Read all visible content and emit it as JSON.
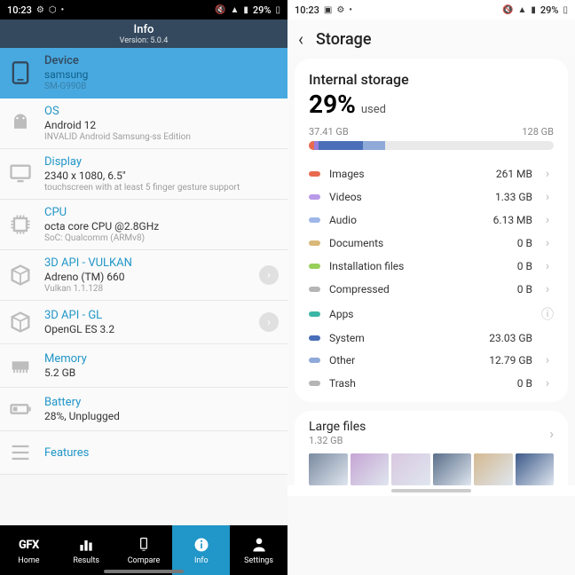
{
  "status": {
    "time": "10:23",
    "left_icons": [
      "gear-icon",
      "shield-icon",
      "dot-icon"
    ],
    "right_icons": [
      "mute-icon",
      "wifi-icon",
      "signal-icon"
    ],
    "battery": "29%"
  },
  "left": {
    "header": {
      "title": "Info",
      "version": "Version: 5.0.4"
    },
    "rows": [
      {
        "icon": "tablet-icon",
        "title": "Device",
        "line1": "samsung",
        "line2": "SM-G990B",
        "selected": true
      },
      {
        "icon": "android-icon",
        "title": "OS",
        "line1": "Android 12",
        "line2": "INVALID Android Samsung-ss Edition"
      },
      {
        "icon": "monitor-icon",
        "title": "Display",
        "line1": "2340 x 1080, 6.5\"",
        "line2": "touchscreen with at least 5 finger gesture support"
      },
      {
        "icon": "cpu-icon",
        "title": "CPU",
        "line1": "octa core CPU @2.8GHz",
        "line2": "SoC: Qualcomm (ARMv8)"
      },
      {
        "icon": "cube-icon",
        "title": "3D API - VULKAN",
        "line1": "Adreno (TM) 660",
        "line2": "Vulkan 1.1.128",
        "chevron": true
      },
      {
        "icon": "cube-icon",
        "title": "3D API - GL",
        "line1": "OpenGL ES 3.2",
        "chevron": true
      },
      {
        "icon": "memory-icon",
        "title": "Memory",
        "line1": "5.2 GB"
      },
      {
        "icon": "battery-icon",
        "title": "Battery",
        "line1": "28%, Unplugged"
      },
      {
        "icon": "list-icon",
        "title": "Features"
      }
    ],
    "nav": [
      {
        "icon": "gfx",
        "label": "Home"
      },
      {
        "icon": "results-icon",
        "label": "Results"
      },
      {
        "icon": "compare-icon",
        "label": "Compare"
      },
      {
        "icon": "info-icon",
        "label": "Info",
        "active": true
      },
      {
        "icon": "settings-icon",
        "label": "Settings"
      }
    ]
  },
  "right": {
    "title": "Storage",
    "card": {
      "heading": "Internal storage",
      "percent": "29%",
      "percent_label": "used",
      "used": "37.41 GB",
      "total": "128 GB"
    },
    "bar_segments": [
      {
        "color": "#e86a4e",
        "w": 2
      },
      {
        "color": "#9a7edc",
        "w": 2
      },
      {
        "color": "#4a6fb8",
        "w": 18
      },
      {
        "color": "#8fa9d8",
        "w": 9
      }
    ],
    "categories": [
      {
        "color": "#e86a4e",
        "name": "Images",
        "value": "261 MB",
        "arrow": true
      },
      {
        "color": "#b89ae8",
        "name": "Videos",
        "value": "1.33 GB",
        "arrow": true
      },
      {
        "color": "#9fb7e8",
        "name": "Audio",
        "value": "6.13 MB",
        "arrow": true
      },
      {
        "color": "#d9b87a",
        "name": "Documents",
        "value": "0 B",
        "arrow": true
      },
      {
        "color": "#97cf5a",
        "name": "Installation files",
        "value": "0 B",
        "arrow": true
      },
      {
        "color": "#b5b5b5",
        "name": "Compressed",
        "value": "0 B",
        "arrow": true
      },
      {
        "color": "#3bb6a6",
        "name": "Apps",
        "value": "",
        "info": true
      },
      {
        "color": "#4a6fb8",
        "name": "System",
        "value": "23.03 GB"
      },
      {
        "color": "#8fa9d8",
        "name": "Other",
        "value": "12.79 GB",
        "arrow": true
      },
      {
        "color": "#b5b5b5",
        "name": "Trash",
        "value": "0 B",
        "arrow": true
      }
    ],
    "large_files": {
      "title": "Large files",
      "size": "1.32 GB"
    },
    "thumbs": [
      "#7a8aa0",
      "#c6a5d4",
      "#d8c7e0",
      "#5a6f8a",
      "#d4b990",
      "#3d5a8a"
    ]
  }
}
